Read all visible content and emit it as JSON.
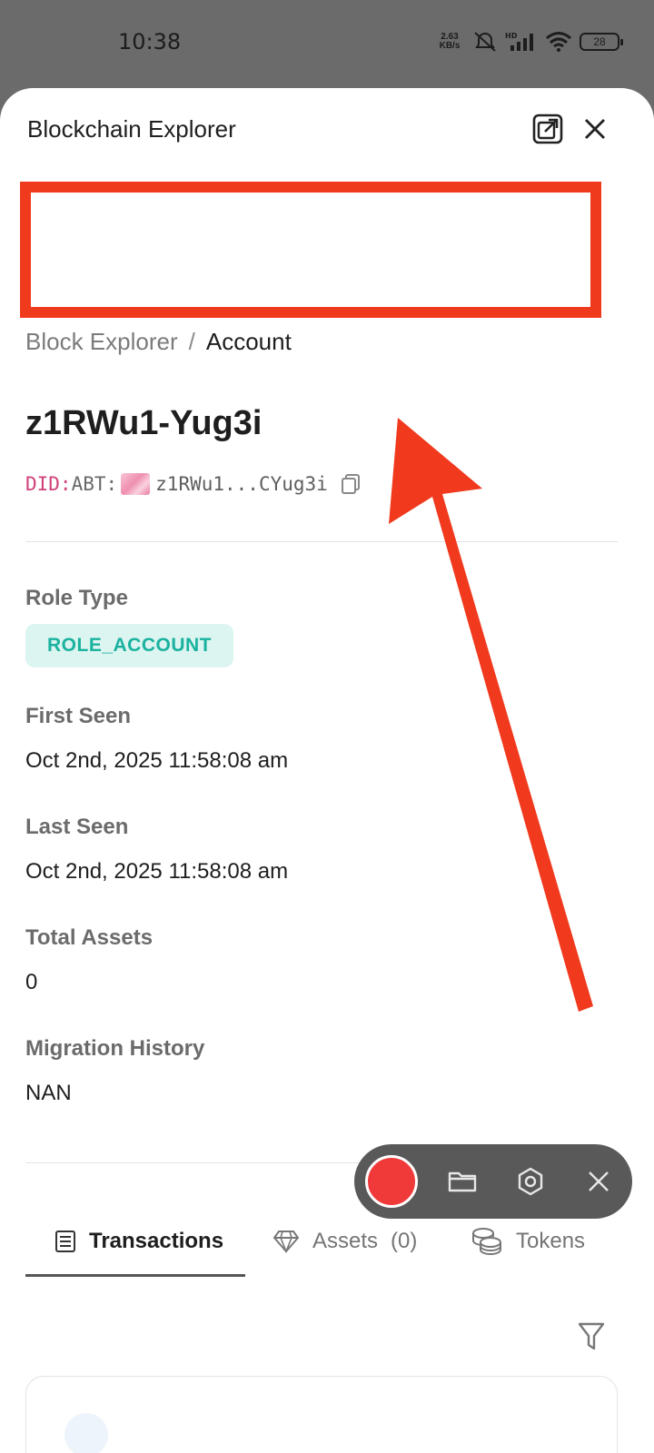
{
  "status_bar": {
    "time": "10:38",
    "net_speed_value": "2.63",
    "net_speed_unit": "KB/s",
    "battery": "28",
    "icons": [
      "mute-alert-icon",
      "hd-signal-icon",
      "wifi-icon",
      "battery-icon"
    ]
  },
  "sheet": {
    "title": "Blockchain Explorer",
    "icons": {
      "open_external": "open-external-icon",
      "close": "close-icon"
    }
  },
  "breadcrumb": {
    "root": "Block Explorer",
    "separator": "/",
    "current": "Account"
  },
  "account": {
    "name": "z1RWu1-Yug3i",
    "did_prefix": "DID:",
    "did_method": "ABT:",
    "did_address": "z1RWu1...CYug3i"
  },
  "fields": {
    "role_type_label": "Role Type",
    "role_type_value": "ROLE_ACCOUNT",
    "first_seen_label": "First Seen",
    "first_seen_value": "Oct 2nd, 2025 11:58:08 am",
    "last_seen_label": "Last Seen",
    "last_seen_value": "Oct 2nd, 2025 11:58:08 am",
    "total_assets_label": "Total Assets",
    "total_assets_value": "0",
    "migration_label": "Migration History",
    "migration_value": "NAN"
  },
  "tabs": [
    {
      "label": "Transactions",
      "icon": "list-icon",
      "active": true
    },
    {
      "label": "Assets",
      "count": "(0)",
      "icon": "diamond-icon",
      "active": false
    },
    {
      "label": "Tokens",
      "icon": "coins-icon",
      "active": false
    }
  ],
  "recorder": {
    "icons": [
      "record-icon",
      "folder-icon",
      "settings-icon",
      "close-icon"
    ]
  },
  "colors": {
    "annotation_red": "#f03a1e",
    "role_badge_bg": "#dcf5f1",
    "role_badge_text": "#1ab29f",
    "did_prefix": "#d0417b",
    "record_red": "#f03a3a"
  }
}
